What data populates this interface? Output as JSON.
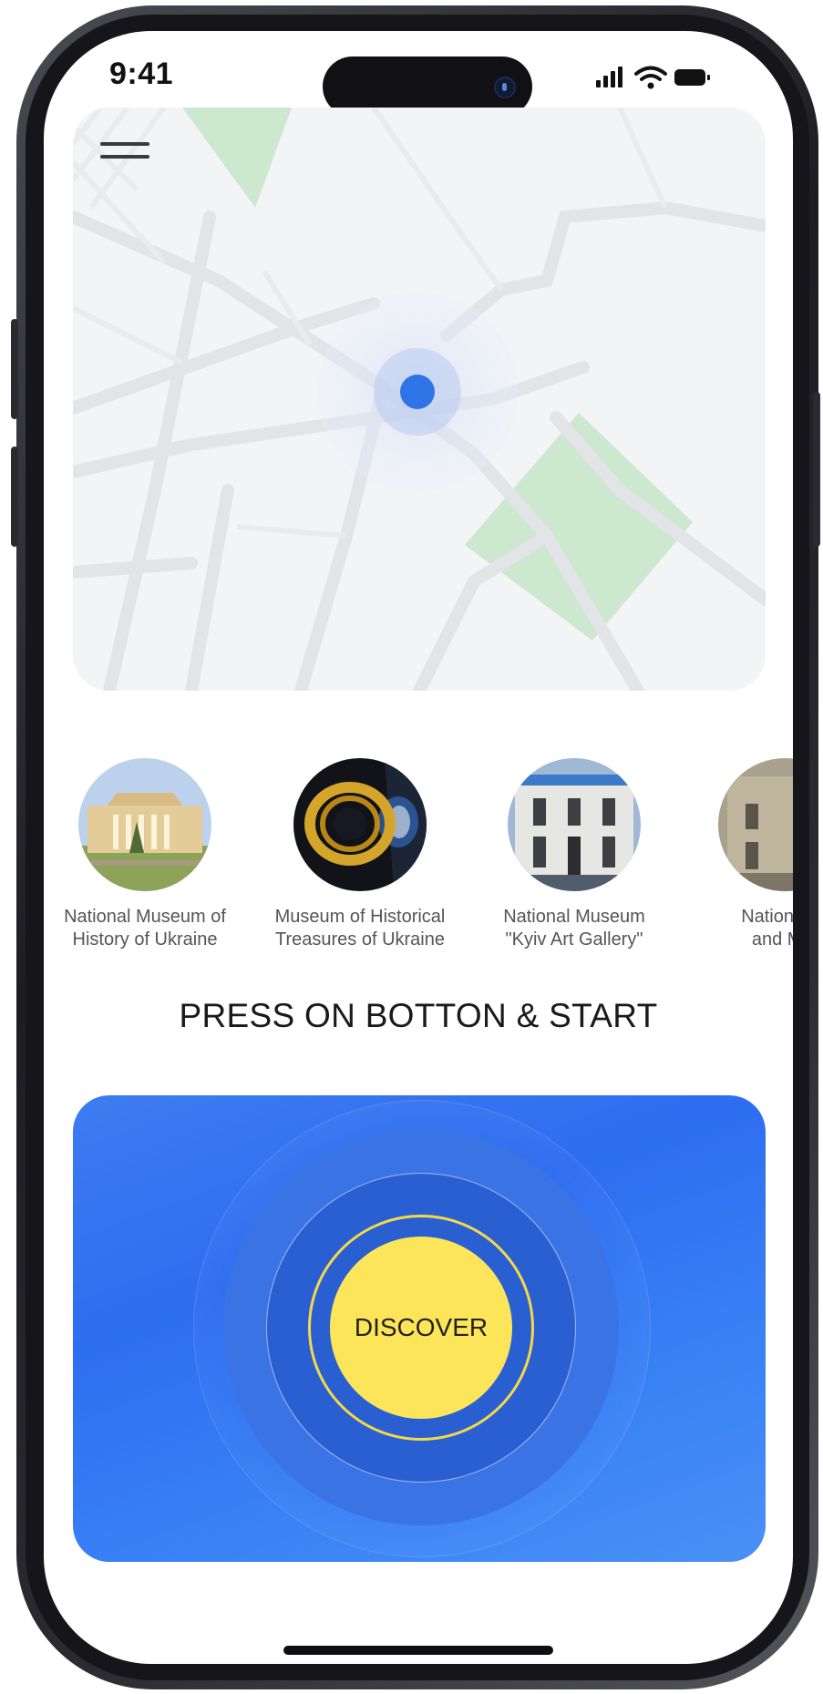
{
  "status_bar": {
    "time": "9:41",
    "icons": [
      "signal-icon",
      "wifi-icon",
      "battery-icon"
    ]
  },
  "map": {
    "menu_icon": "hamburger-menu-icon",
    "location_icon": "current-location-dot-icon"
  },
  "museums": [
    {
      "label": "National Museum of\nHistory of Ukraine"
    },
    {
      "label": "Museum of Historical\nTreasures of Ukraine"
    },
    {
      "label": "National Museum\n\"Kyiv Art Gallery\""
    },
    {
      "label": "National ...\nand M..."
    }
  ],
  "section_title": "PRESS ON BOTTON & START",
  "discover": {
    "button_label": "DISCOVER"
  },
  "colors": {
    "accent_blue": "#2e6df0",
    "discover_yellow": "#fde55a",
    "map_park_green": "#cce8cf",
    "location_blue": "#2e74e6"
  }
}
